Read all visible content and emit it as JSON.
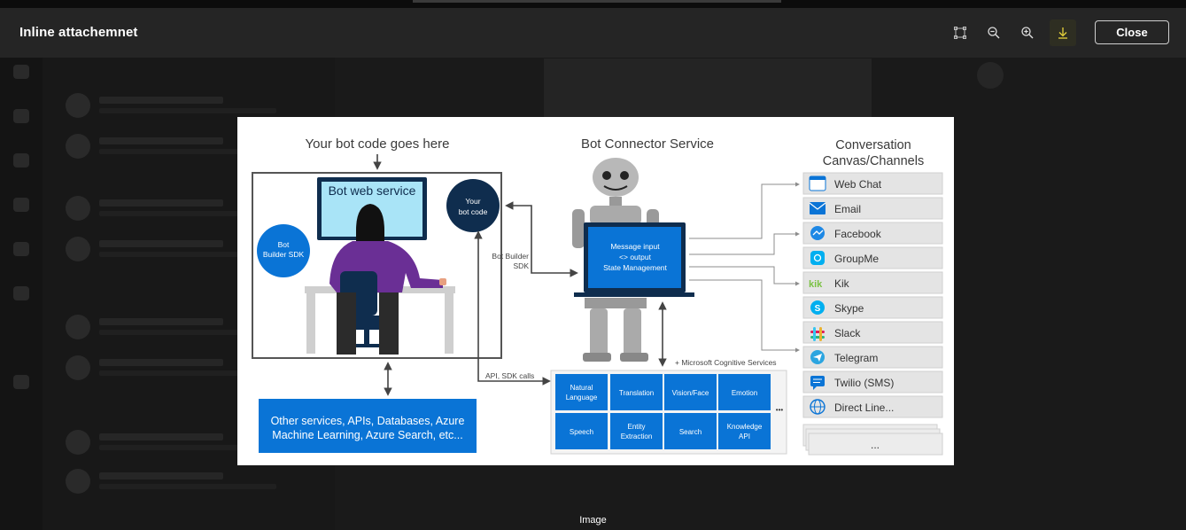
{
  "header": {
    "title": "Inline attachemnet",
    "close_label": "Close",
    "icons": [
      "fit-to-screen-icon",
      "zoom-out-icon",
      "zoom-in-icon",
      "download-icon"
    ]
  },
  "caption": "Image",
  "diagram": {
    "left_heading": "Your bot code goes here",
    "bot_web_service": "Bot web service",
    "your_bot_code": [
      "Your",
      "bot code"
    ],
    "bot_builder_sdk": [
      "Bot",
      "Builder SDK"
    ],
    "bot_builder_sdk_label": [
      "Bot Builder",
      "SDK"
    ],
    "other_services": [
      "Other services, APIs, Databases, Azure",
      "Machine Learning, Azure Search, etc..."
    ],
    "api_sdk_calls": "API, SDK calls",
    "connector_heading": "Bot Connector Service",
    "laptop_screen": [
      "Message input",
      "<> output",
      "State Management"
    ],
    "cognitive_label": "+ Microsoft Cognitive Services",
    "cognitive_tiles": [
      [
        "Natural",
        "Language"
      ],
      [
        "Translation"
      ],
      [
        "Vision/Face"
      ],
      [
        "Emotion"
      ],
      [
        "Speech"
      ],
      [
        "Entity",
        "Extraction"
      ],
      [
        "Search"
      ],
      [
        "Knowledge",
        "API"
      ]
    ],
    "ellipsis": "•••",
    "channels_heading": [
      "Conversation",
      "Canvas/Channels"
    ],
    "channels": [
      "Web Chat",
      "Email",
      "Facebook",
      "GroupMe",
      "Kik",
      "Skype",
      "Slack",
      "Telegram",
      "Twilio (SMS)",
      "Direct Line..."
    ],
    "channels_more": "...",
    "colors": {
      "azure_blue": "#0a74d6",
      "navy": "#0f2d4e",
      "purple": "#6a2f95",
      "screen": "#a9e4f7"
    }
  }
}
